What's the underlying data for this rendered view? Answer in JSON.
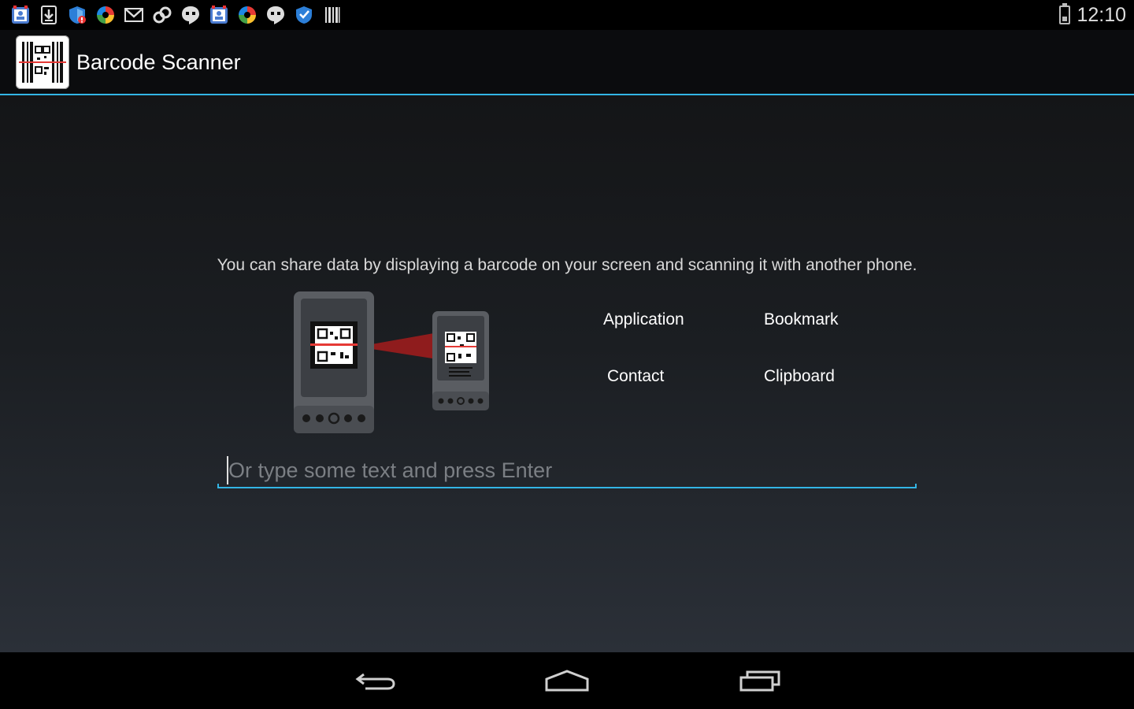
{
  "status_bar": {
    "time": "12:10",
    "notification_icons": [
      "contacts-icon",
      "download-icon",
      "shield-alert-icon",
      "pinwheel-icon",
      "gmail-icon",
      "link-icon",
      "hangouts-icon",
      "contacts-icon",
      "pinwheel-icon",
      "hangouts-icon",
      "shield-icon",
      "barcode-icon"
    ]
  },
  "action_bar": {
    "title": "Barcode Scanner"
  },
  "main": {
    "info_text": "You can share data by displaying a barcode on your screen and scanning it with another phone.",
    "share_options": {
      "application": "Application",
      "bookmark": "Bookmark",
      "contact": "Contact",
      "clipboard": "Clipboard"
    },
    "input": {
      "placeholder": "Or type some text and press Enter",
      "value": ""
    }
  },
  "colors": {
    "accent": "#33b5e5",
    "scan_line": "#d32f2f"
  }
}
